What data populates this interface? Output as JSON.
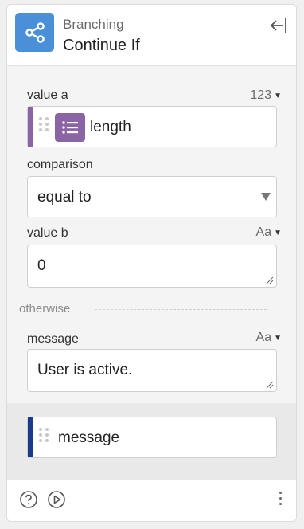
{
  "header": {
    "category": "Branching",
    "title": "Continue If",
    "icon": "share-branch-icon",
    "icon_color": "#4a90d9"
  },
  "fields": {
    "value_a": {
      "label": "value a",
      "type_indicator": "123",
      "pill_text": "length",
      "pill_color": "#8b64a6"
    },
    "comparison": {
      "label": "comparison",
      "selected": "equal to"
    },
    "value_b": {
      "label": "value b",
      "type_indicator": "Aa",
      "value": "0"
    },
    "otherwise_label": "otherwise",
    "message": {
      "label": "message",
      "type_indicator": "Aa",
      "value": "User is active."
    }
  },
  "output": {
    "pill_text": "message",
    "pill_color": "#1a3a8c"
  },
  "footer": {
    "icons": [
      "help-icon",
      "play-icon",
      "more-vertical-icon"
    ]
  }
}
